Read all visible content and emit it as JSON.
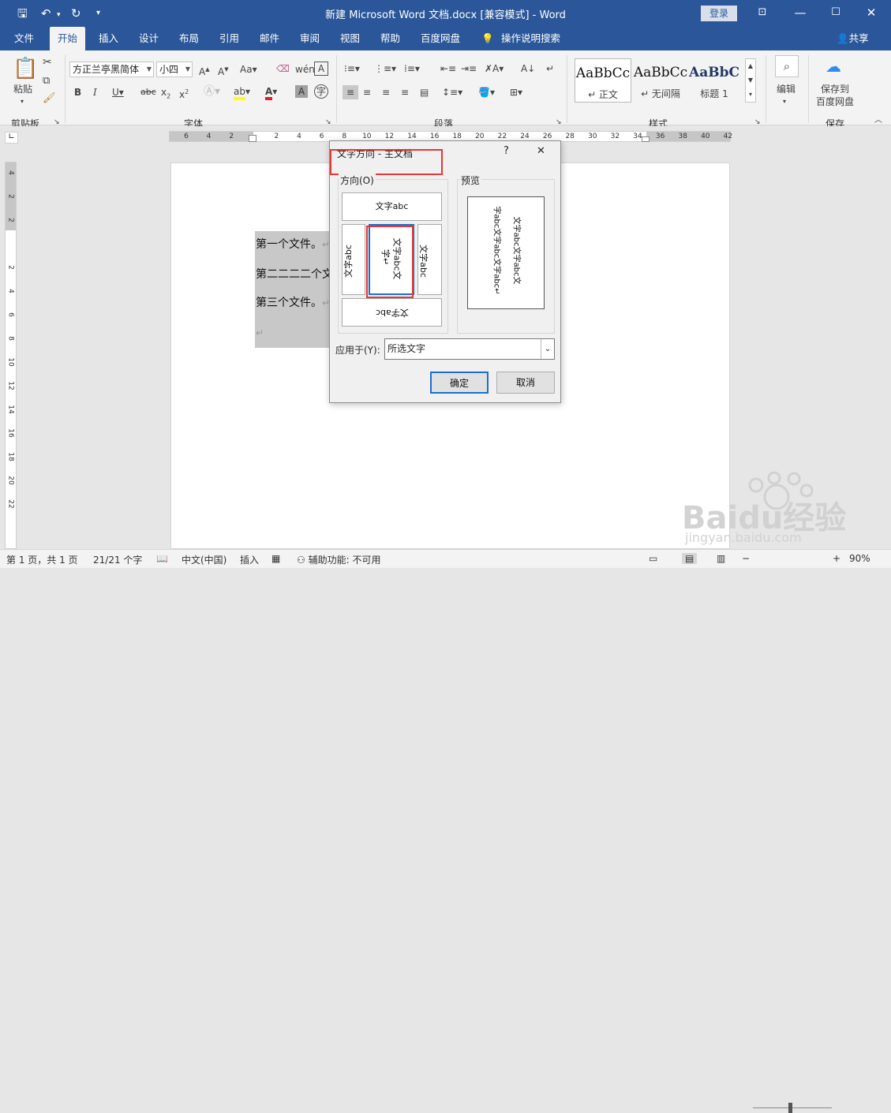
{
  "window": {
    "title": "新建 Microsoft Word 文档.docx [兼容模式] - Word",
    "login_label": "登录",
    "quick_access": [
      "save-icon",
      "undo-icon",
      "redo-icon",
      "customize-icon"
    ]
  },
  "tabs": [
    "文件",
    "开始",
    "插入",
    "设计",
    "布局",
    "引用",
    "邮件",
    "审阅",
    "视图",
    "帮助",
    "百度网盘",
    "操作说明搜索"
  ],
  "share_label": "共享",
  "ribbon": {
    "clipboard": {
      "paste_label": "粘贴",
      "group_label": "剪贴板"
    },
    "font": {
      "name": "方正兰亭黑简体",
      "size": "小四",
      "group_label": "字体",
      "highlight_color": "#ffff00",
      "font_color": "#e02020"
    },
    "paragraph": {
      "group_label": "段落"
    },
    "styles": {
      "group_label": "样式",
      "items": [
        {
          "preview": "AaBbCc",
          "label": "↵ 正文"
        },
        {
          "preview": "AaBbCc",
          "label": "↵ 无间隔"
        },
        {
          "preview": "AaBbC",
          "label": "标题 1"
        }
      ]
    },
    "editing": {
      "label": "编辑"
    },
    "save": {
      "line1": "保存到",
      "line2": "百度网盘",
      "group_label": "保存"
    }
  },
  "ruler": {
    "h": [
      "6",
      "4",
      "2",
      "",
      "2",
      "4",
      "6",
      "8",
      "10",
      "12",
      "14",
      "16",
      "18",
      "20",
      "22",
      "24",
      "26",
      "28",
      "30",
      "32",
      "34",
      "36",
      "38",
      "40",
      "42"
    ],
    "v": [
      "4",
      "2",
      "2",
      "",
      "2",
      "4",
      "6",
      "8",
      "10",
      "12",
      "14",
      "16",
      "18",
      "20",
      "22"
    ]
  },
  "document": {
    "lines": [
      "第一个文件。",
      "第二二二二个文",
      "第三个文件。"
    ],
    "paragraph_mark": "↵"
  },
  "dialog": {
    "title": "文字方向 - 主文档",
    "help": "?",
    "close": "✕",
    "direction_label": "方向(O)",
    "preview_label": "预览",
    "options": {
      "horizontal": "文字abc",
      "rotated_left": "文字abc",
      "vertical_col1": "文字abc文",
      "vertical_col2": "字↵",
      "rotated_right": "文字abc",
      "horizontal_flipped": "文字abc"
    },
    "preview_lines": [
      "文字abc文字abc文",
      "字abc文字abc文字abc↵"
    ],
    "apply_label": "应用于(Y):",
    "apply_value": "所选文字",
    "ok": "确定",
    "cancel": "取消"
  },
  "status": {
    "page": "第 1 页，共 1 页",
    "words": "21/21 个字",
    "language": "中文(中国)",
    "mode": "插入",
    "accessibility": "辅助功能: 不可用",
    "zoom": "90%"
  },
  "watermark": {
    "brand": "Baidu经验",
    "url": "jingyan.baidu.com"
  }
}
